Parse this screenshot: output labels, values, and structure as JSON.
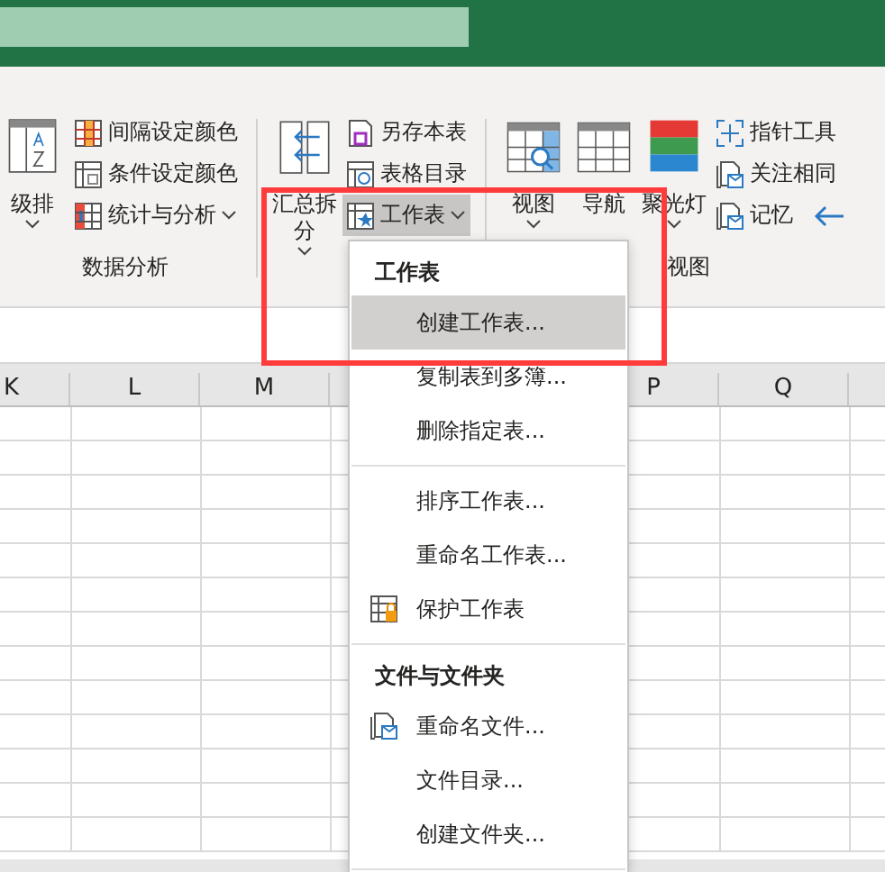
{
  "ribbon": {
    "groups": [
      {
        "label": "数据分析",
        "buttons": [
          {
            "kind": "large",
            "label": "级排",
            "caret": true
          },
          {
            "kind": "small",
            "label": "间隔设定颜色"
          },
          {
            "kind": "small",
            "label": "条件设定颜色"
          },
          {
            "kind": "small",
            "label": "统计与分析",
            "caret": true
          }
        ]
      },
      {
        "buttons": [
          {
            "kind": "large",
            "label": "汇总拆分",
            "caret": true
          },
          {
            "kind": "small",
            "label": "另存本表"
          },
          {
            "kind": "small",
            "label": "表格目录"
          },
          {
            "kind": "small",
            "label": "工作表",
            "caret": true,
            "pressed": true
          }
        ]
      },
      {
        "label": "视图",
        "buttons": [
          {
            "kind": "large",
            "label": "视图",
            "caret": true
          },
          {
            "kind": "large",
            "label": "导航"
          },
          {
            "kind": "large",
            "label": "聚光灯",
            "caret": true
          },
          {
            "kind": "small",
            "label": "指针工具"
          },
          {
            "kind": "small",
            "label": "关注相同"
          },
          {
            "kind": "small",
            "label": "记忆",
            "arrow": true
          }
        ]
      }
    ]
  },
  "columns_left": [
    "K",
    "L",
    "M"
  ],
  "columns_right": [
    "P",
    "Q"
  ],
  "menu": {
    "items": [
      {
        "kind": "header",
        "label": "工作表"
      },
      {
        "kind": "item",
        "label": "创建工作表...",
        "highlighted": true
      },
      {
        "kind": "item",
        "label": "复制表到多簿...",
        "highlighted": false
      },
      {
        "kind": "item",
        "label": "删除指定表...",
        "highlighted": false
      },
      {
        "kind": "separator"
      },
      {
        "kind": "item",
        "label": "排序工作表...",
        "highlighted": false
      },
      {
        "kind": "item",
        "label": "重命名工作表...",
        "highlighted": false
      },
      {
        "kind": "item",
        "label": "保护工作表",
        "highlighted": false
      },
      {
        "kind": "separator"
      },
      {
        "kind": "header",
        "label": "文件与文件夹"
      },
      {
        "kind": "item",
        "label": "重命名文件...",
        "highlighted": false
      },
      {
        "kind": "item",
        "label": "文件目录...",
        "highlighted": false
      },
      {
        "kind": "item",
        "label": "创建文件夹...",
        "highlighted": false
      },
      {
        "kind": "separator"
      }
    ]
  }
}
